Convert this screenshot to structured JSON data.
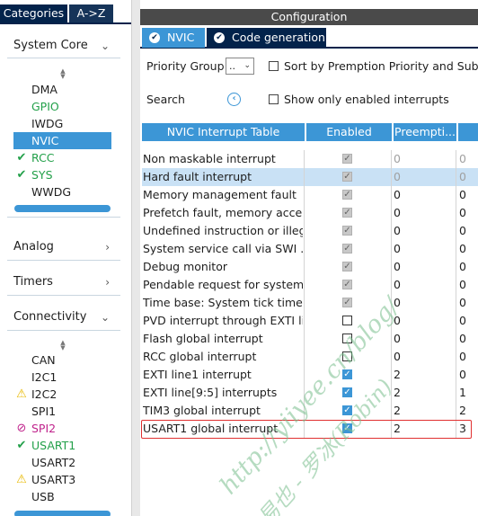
{
  "left_panel": {
    "tabs": [
      "Categories",
      "A->Z"
    ],
    "sections": {
      "system_core": "System Core",
      "analog": "Analog",
      "timers": "Timers",
      "connectivity": "Connectivity"
    },
    "system_core_items": [
      {
        "label": "DMA",
        "state": "normal"
      },
      {
        "label": "GPIO",
        "state": "green"
      },
      {
        "label": "IWDG",
        "state": "normal"
      },
      {
        "label": "NVIC",
        "state": "selected"
      },
      {
        "label": "RCC",
        "state": "check"
      },
      {
        "label": "SYS",
        "state": "check"
      },
      {
        "label": "WWDG",
        "state": "normal"
      }
    ],
    "connectivity_items": [
      {
        "label": "CAN",
        "state": "normal"
      },
      {
        "label": "I2C1",
        "state": "normal"
      },
      {
        "label": "I2C2",
        "state": "warning"
      },
      {
        "label": "SPI1",
        "state": "normal"
      },
      {
        "label": "SPI2",
        "state": "disabled"
      },
      {
        "label": "USART1",
        "state": "check"
      },
      {
        "label": "USART2",
        "state": "normal"
      },
      {
        "label": "USART3",
        "state": "warning"
      },
      {
        "label": "USB",
        "state": "normal"
      }
    ]
  },
  "right_panel": {
    "header": "Configuration",
    "tabs": [
      "NVIC",
      "Code generation"
    ],
    "priority_group_label": "Priority Group",
    "priority_group_value": "..",
    "sort_label": "Sort by Premption Priority and Sub P",
    "search_label": "Search",
    "show_enabled_label": "Show only enabled interrupts",
    "columns": [
      "NVIC Interrupt Table",
      "Enabled",
      "Preempti...",
      ""
    ],
    "rows": [
      {
        "name": "Non maskable interrupt",
        "enabled": "disabled",
        "preempt": "0",
        "sub": "0",
        "gray": true
      },
      {
        "name": "Hard fault interrupt",
        "enabled": "disabled",
        "preempt": "0",
        "sub": "0",
        "gray": true,
        "highlight": true
      },
      {
        "name": "Memory management fault",
        "enabled": "disabled",
        "preempt": "0",
        "sub": "0"
      },
      {
        "name": "Prefetch fault, memory acce...",
        "enabled": "disabled",
        "preempt": "0",
        "sub": "0"
      },
      {
        "name": "Undefined instruction or illeg...",
        "enabled": "disabled",
        "preempt": "0",
        "sub": "0"
      },
      {
        "name": "System service call via SWI ...",
        "enabled": "disabled",
        "preempt": "0",
        "sub": "0"
      },
      {
        "name": "Debug monitor",
        "enabled": "disabled",
        "preempt": "0",
        "sub": "0"
      },
      {
        "name": "Pendable request for system...",
        "enabled": "disabled",
        "preempt": "0",
        "sub": "0"
      },
      {
        "name": "Time base: System tick timer",
        "enabled": "disabled",
        "preempt": "0",
        "sub": "0"
      },
      {
        "name": "PVD interrupt through EXTI li...",
        "enabled": "off",
        "preempt": "0",
        "sub": "0"
      },
      {
        "name": "Flash global interrupt",
        "enabled": "off",
        "preempt": "0",
        "sub": "0"
      },
      {
        "name": "RCC global interrupt",
        "enabled": "off",
        "preempt": "0",
        "sub": "0"
      },
      {
        "name": "EXTI line1 interrupt",
        "enabled": "on",
        "preempt": "2",
        "sub": "0"
      },
      {
        "name": "EXTI line[9:5] interrupts",
        "enabled": "on",
        "preempt": "2",
        "sub": "1"
      },
      {
        "name": "TIM3 global interrupt",
        "enabled": "on",
        "preempt": "2",
        "sub": "2"
      },
      {
        "name": "USART1 global interrupt",
        "enabled": "on",
        "preempt": "2",
        "sub": "3"
      }
    ]
  },
  "watermark": {
    "line1": "http://yiiyee.cn/blog/",
    "line2": "易也 - 罗冰(Robin)"
  },
  "colors": {
    "navy": "#03234b",
    "accent_blue": "#3c96d6",
    "green": "#23a04a",
    "highlight_red": "#e03030"
  }
}
